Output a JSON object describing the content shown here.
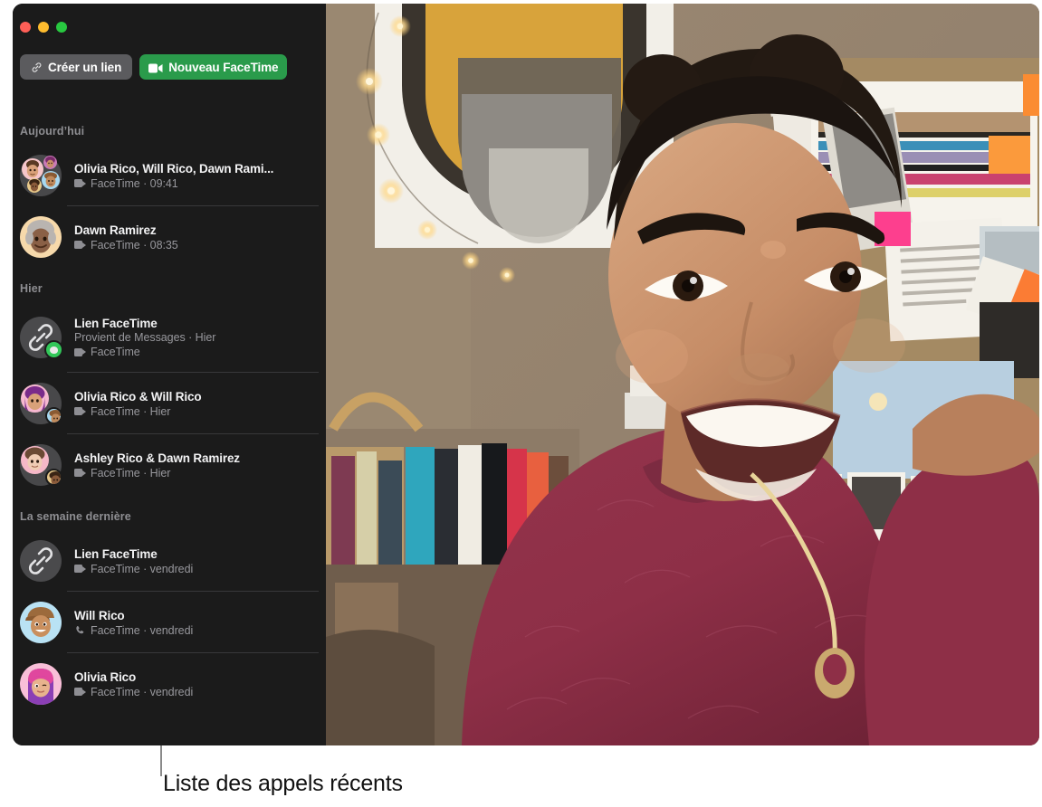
{
  "window": {
    "traffic_lights": {
      "close": "close-button",
      "minimize": "minimize-button",
      "zoom": "zoom-button",
      "close_color": "#ff5f57",
      "minimize_color": "#febc2e",
      "zoom_color": "#28c840"
    }
  },
  "toolbar": {
    "create_link_label": "Créer un lien",
    "new_facetime_label": "Nouveau FaceTime",
    "primary_color": "#2a9b4b",
    "secondary_color": "#5b5b5e"
  },
  "sections": [
    {
      "header": "Aujourd’hui",
      "rows": [
        {
          "title": "Olivia Rico, Will Rico, Dawn Rami...",
          "subtitle": "FaceTime · 09:41",
          "icon": "video-camera-icon",
          "avatar": "group-memoji-avatar",
          "badge": null,
          "source": null
        },
        {
          "title": "Dawn Ramirez",
          "subtitle": "FaceTime · 08:35",
          "icon": "video-camera-icon",
          "avatar": "memoji-gray-hair-avatar",
          "badge": null,
          "source": null
        }
      ]
    },
    {
      "header": "Hier",
      "rows": [
        {
          "title": "Lien FaceTime",
          "source": "Provient de Messages · Hier",
          "subtitle": "FaceTime",
          "icon": "video-camera-icon",
          "avatar": "facetime-link-icon",
          "badge": "messages-badge"
        },
        {
          "title": "Olivia Rico & Will Rico",
          "subtitle": "FaceTime · Hier",
          "icon": "video-camera-icon",
          "avatar": "pair-memoji-avatar",
          "badge": null,
          "source": null
        },
        {
          "title": "Ashley Rico & Dawn Ramirez",
          "subtitle": "FaceTime · Hier",
          "icon": "video-camera-icon",
          "avatar": "pair-memoji-avatar",
          "badge": null,
          "source": null
        }
      ]
    },
    {
      "header": "La semaine dernière",
      "rows": [
        {
          "title": "Lien FaceTime",
          "subtitle": "FaceTime · vendredi",
          "icon": "video-camera-icon",
          "avatar": "facetime-link-icon",
          "badge": null,
          "source": null
        },
        {
          "title": "Will Rico",
          "subtitle": "FaceTime · vendredi",
          "icon": "phone-icon",
          "avatar": "memoji-cap-avatar",
          "badge": null,
          "source": null
        },
        {
          "title": "Olivia Rico",
          "subtitle": "FaceTime · vendredi",
          "icon": "video-camera-icon",
          "avatar": "memoji-pink-hair-avatar",
          "badge": null,
          "source": null
        }
      ]
    }
  ],
  "annotation": {
    "caption": "Liste des appels récents"
  },
  "video": {
    "description": "active-facetime-video-feed"
  }
}
